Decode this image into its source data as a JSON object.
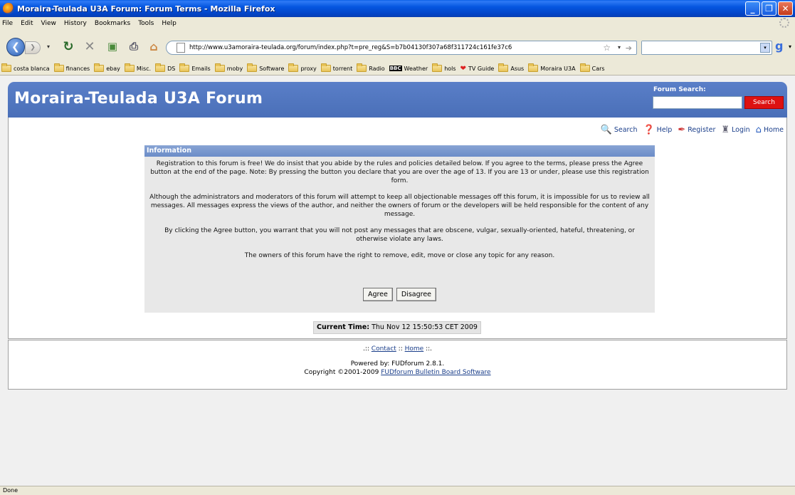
{
  "window": {
    "title": "Moraira-Teulada U3A Forum: Forum Terms - Mozilla Firefox",
    "buttons": [
      "_",
      "❐",
      "✕"
    ]
  },
  "menu": [
    "File",
    "Edit",
    "View",
    "History",
    "Bookmarks",
    "Tools",
    "Help"
  ],
  "nav": {
    "url": "http://www.u3amoraira-teulada.org/forum/index.php?t=pre_reg&S=b7b04130f307a68f311724c161fe37c6",
    "search_value": ""
  },
  "bookmarks": [
    {
      "label": "costa blanca",
      "icon": "folder-icon"
    },
    {
      "label": "finances",
      "icon": "folder-icon"
    },
    {
      "label": "ebay",
      "icon": "folder-icon"
    },
    {
      "label": "Misc.",
      "icon": "folder-icon"
    },
    {
      "label": "DS",
      "icon": "folder-icon"
    },
    {
      "label": "Emails",
      "icon": "folder-icon"
    },
    {
      "label": "moby",
      "icon": "folder-icon"
    },
    {
      "label": "Software",
      "icon": "folder-icon"
    },
    {
      "label": "proxy",
      "icon": "folder-icon"
    },
    {
      "label": "torrent",
      "icon": "folder-icon"
    },
    {
      "label": "Radio",
      "icon": "folder-icon"
    },
    {
      "label": "Weather",
      "icon": "bbc-icon"
    },
    {
      "label": "hols",
      "icon": "folder-icon"
    },
    {
      "label": "TV Guide",
      "icon": "heart-icon"
    },
    {
      "label": "Asus",
      "icon": "folder-icon"
    },
    {
      "label": "Moraira U3A",
      "icon": "folder-icon"
    },
    {
      "label": "Cars",
      "icon": "folder-icon"
    }
  ],
  "forum": {
    "title": "Moraira-Teulada U3A Forum",
    "search_label": "Forum Search:",
    "search_button": "Search",
    "toplinks": {
      "search": "Search",
      "help": "Help",
      "register": "Register",
      "login": "Login",
      "home": "Home"
    },
    "info": {
      "heading": "Information",
      "p1": "Registration to this forum is free! We do insist that you abide by the rules and policies detailed below. If you agree to the terms, please press the Agree button at the end of the page. Note: By pressing the button you declare that you are over the age of 13. If you are 13 or under, please use this registration form.",
      "p2": "Although the administrators and moderators of this forum will attempt to keep all objectionable messages off this forum, it is impossible for us to review all messages. All messages express the views of the author, and neither the owners of forum or the developers will be held responsible for the content of any message.",
      "p3": "By clicking the Agree button, you warrant that you will not post any messages that are obscene, vulgar, sexually-oriented, hateful, threatening, or otherwise violate any laws.",
      "p4": "The owners of this forum have the right to remove, edit, move or close any topic for any reason.",
      "agree": "Agree",
      "disagree": "Disagree"
    },
    "current_time_label": "Current Time:",
    "current_time_value": "Thu Nov 12 15:50:53 CET 2009",
    "footer": {
      "sep_left": ".::",
      "contact": "Contact",
      "sep_mid": "::",
      "home": "Home",
      "sep_right": "::.",
      "powered": "Powered by: FUDforum 2.8.1.",
      "copyright": "Copyright ©2001-2009",
      "fud_link": "FUDforum Bulletin Board Software"
    }
  },
  "status": "Done"
}
